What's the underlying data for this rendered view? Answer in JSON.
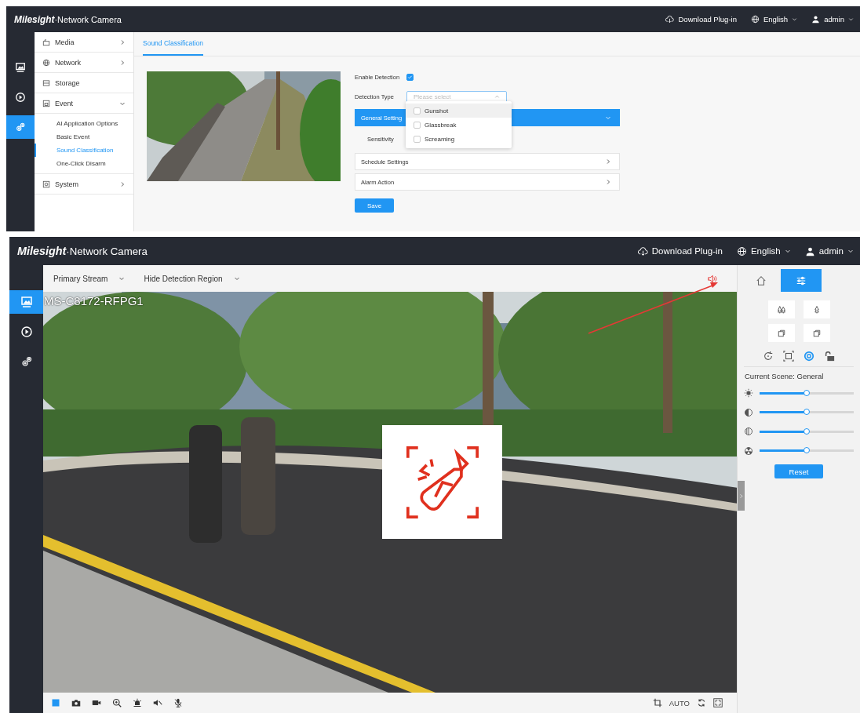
{
  "settings_screen": {
    "header": {
      "brand": "Milesight",
      "title": "·Network Camera",
      "actions": [
        {
          "kind": "download",
          "label": "Download Plug-in"
        },
        {
          "kind": "language",
          "label": "English"
        },
        {
          "kind": "user",
          "label": "admin"
        }
      ]
    },
    "rail": [
      {
        "kind": "live",
        "selected": false
      },
      {
        "kind": "playback",
        "selected": false
      },
      {
        "kind": "settings",
        "selected": true
      }
    ],
    "menu": [
      {
        "kind": "media",
        "label": "Media",
        "expanded": false
      },
      {
        "kind": "network",
        "label": "Network",
        "expanded": false
      },
      {
        "kind": "storage",
        "label": "Storage"
      },
      {
        "kind": "event",
        "label": "Event",
        "expanded": true,
        "children": [
          {
            "label": "AI Application Options",
            "selected": false
          },
          {
            "label": "Basic Event",
            "selected": false
          },
          {
            "label": "Sound Classification",
            "selected": true
          },
          {
            "label": "One-Click Disarm",
            "selected": false
          }
        ]
      },
      {
        "kind": "system",
        "label": "System",
        "expanded": false
      }
    ],
    "tabs": [
      {
        "label": "Sound Classification",
        "selected": true
      }
    ],
    "enable_detection": {
      "label": "Enable Detection",
      "checked": true
    },
    "detection_type": {
      "label": "Detection Type",
      "placeholder": "Please select",
      "open": true,
      "options": [
        {
          "label": "Gunshot",
          "checked": false,
          "hovered": true
        },
        {
          "label": "Glassbreak",
          "checked": false,
          "hovered": false
        },
        {
          "label": "Screaming",
          "checked": false,
          "hovered": false
        }
      ]
    },
    "sections": [
      {
        "label": "General Setting",
        "expanded": true,
        "fields": [
          {
            "label": "Sensitivity"
          }
        ]
      },
      {
        "label": "Schedule Settings",
        "expanded": false
      },
      {
        "label": "Alarm Action",
        "expanded": false
      }
    ],
    "save_button": "Save"
  },
  "live_screen": {
    "header": {
      "brand": "Milesight",
      "title": "·Network Camera",
      "actions": [
        {
          "kind": "download",
          "label": "Download Plug-in"
        },
        {
          "kind": "language",
          "label": "English"
        },
        {
          "kind": "user",
          "label": "admin"
        }
      ]
    },
    "rail": [
      {
        "kind": "live",
        "selected": true
      },
      {
        "kind": "playback",
        "selected": false
      },
      {
        "kind": "settings",
        "selected": false
      }
    ],
    "toolbar": {
      "selects": [
        {
          "value": "Primary Stream"
        },
        {
          "value": "Hide Detection Region"
        }
      ],
      "alert_icon": {
        "kind": "speaker"
      }
    },
    "video": {
      "kind": "picture",
      "overlay_text": "MS-C8172-RFPG1",
      "detection_popup": {
        "kind": "glassbreak"
      },
      "annotations": [
        {
          "kind": "arrow"
        }
      ]
    },
    "panel": {
      "tabs": [
        {
          "kind": "home",
          "selected": false
        },
        {
          "kind": "adjust",
          "selected": true
        }
      ],
      "scene_buttons": [
        {
          "kind": "trees"
        },
        {
          "kind": "tree"
        },
        {
          "kind": "copy"
        },
        {
          "kind": "copy"
        }
      ],
      "modes": [
        {
          "kind": "rotate",
          "selected": false
        },
        {
          "kind": "fit",
          "selected": false
        },
        {
          "kind": "iris",
          "selected": true
        },
        {
          "kind": "lock",
          "selected": false
        }
      ],
      "scene_label": "Current Scene: General",
      "sliders": [
        {
          "kind": "brightness",
          "level": 0.5
        },
        {
          "kind": "contrast",
          "level": 0.5
        },
        {
          "kind": "saturation",
          "level": 0.5
        },
        {
          "kind": "sharpness",
          "level": 0.5
        }
      ],
      "reset_button": "Reset"
    },
    "bottom_bar": {
      "left": [
        {
          "kind": "stop",
          "selected": true
        },
        {
          "kind": "snapshot",
          "selected": false
        },
        {
          "kind": "record",
          "selected": false
        },
        {
          "kind": "zoom",
          "selected": false
        },
        {
          "kind": "alarm",
          "selected": false
        },
        {
          "kind": "mute",
          "selected": false
        },
        {
          "kind": "talk",
          "selected": false
        }
      ],
      "right": [
        {
          "kind": "crop"
        },
        {
          "kind": "text",
          "label": "AUTO"
        },
        {
          "kind": "refresh"
        },
        {
          "kind": "fullscreen"
        }
      ]
    }
  }
}
